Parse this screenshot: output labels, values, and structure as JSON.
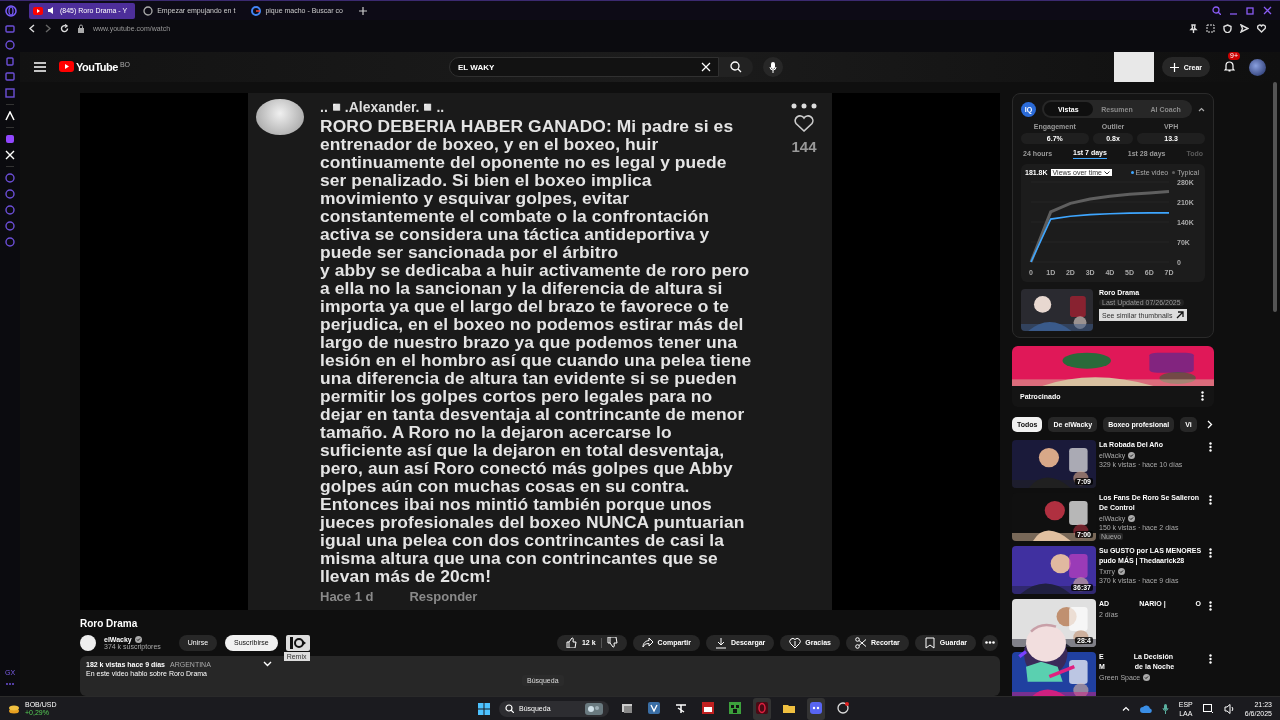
{
  "browser": {
    "tabs": [
      {
        "label": "(845) Roro Drama - Y",
        "selected": true,
        "kind": "youtube"
      },
      {
        "label": "Empezar empujando en t",
        "selected": false,
        "kind": "web"
      },
      {
        "label": "pique macho - Buscar co",
        "selected": false,
        "kind": "google"
      }
    ],
    "url": "www.youtube.com/watch",
    "sidebar_label": "GX"
  },
  "header": {
    "logo": "YouTube",
    "country": "BO",
    "search": {
      "value": "EL WAKY"
    },
    "create": "Crear",
    "notifications": "9+"
  },
  "comment": {
    "author": "..◽.Alexander.◽..",
    "text": "RORO DEBERIA HABER GANADO: Mi padre si es\nentrenador de boxeo, y en el boxeo, huir\ncontinuamente del oponente no es legal y puede\nser penalizado. Si bien el boxeo implica\nmovimiento y esquivar golpes, evitar\nconstantemente el combate o la confrontación\nactiva se considera una táctica antideportiva y\npuede ser sancionada por el árbitro\ny abby se dedicaba a huir activamente de roro pero\na ella no la sancionan y la diferencia de altura si\nimporta ya que el largo del brazo te favorece o te\nperjudica, en el boxeo no podemos estirar más del\nlargo de nuestro brazo ya que podemos tener una\nlesión en el hombro así que cuando una pelea tiene\nuna diferencia de altura tan evidente si se pueden\npermitir los golpes cortos pero legales para no\ndejar en tanta desventaja al contrincante de menor\ntamaño. A Roro no la dejaron acercarse lo\nsuficiente así que la dejaron en total desventaja,\npero, aun así Roro conectó más golpes que Abby\ngolpes aún con muchas cosas en su contra.\nEntonces ibai nos mintió también porque unos\njueces profesionales del boxeo NUNCA puntuarian\nigual una pelea con dos contrincantes de casi la\nmisma altura que una con contrincantes que se\nllevan más de 20cm!",
    "likes": "144",
    "time": "Hace 1 d",
    "reply": "Responder"
  },
  "video": {
    "title": "Roro Drama",
    "channel": "elWacky",
    "subscribers": "374 k suscriptores",
    "join": "Unirse",
    "subscribe": "Suscribirse",
    "remix_tooltip": "Remix",
    "likes": "12 k",
    "actions": [
      {
        "label": "Compartir",
        "kind": "share"
      },
      {
        "label": "Descargar",
        "kind": "download"
      },
      {
        "label": "Gracias",
        "kind": "thanks"
      },
      {
        "label": "Recortar",
        "kind": "clip"
      },
      {
        "label": "Guardar",
        "kind": "save"
      }
    ],
    "description": {
      "stats": "182 k vistas hace 9 días",
      "country": "ARGENTINA",
      "text": "En este video hablo sobre Roro Drama"
    }
  },
  "extension": {
    "badge": "IQ",
    "tabs": [
      {
        "label": "Vistas",
        "selected": true
      },
      {
        "label": "Resumen",
        "selected": false
      },
      {
        "label": "AI Coach",
        "selected": false
      }
    ],
    "stats": [
      {
        "label": "Engagement",
        "value": "6.7%"
      },
      {
        "label": "Outlier",
        "value": "0.8x"
      },
      {
        "label": "VPH",
        "value": "13.3"
      }
    ],
    "periods": [
      {
        "label": "24 hours",
        "selected": false,
        "disabled": false
      },
      {
        "label": "1st 7 days",
        "selected": true,
        "disabled": false
      },
      {
        "label": "1st 28 days",
        "selected": false,
        "disabled": false
      },
      {
        "label": "Todo",
        "selected": false,
        "disabled": true
      }
    ],
    "total": "181.8K",
    "metric": "Views over time",
    "chart_data": {
      "type": "line",
      "xlim": [
        0,
        7
      ],
      "x": [
        0,
        1,
        2,
        3,
        4,
        5,
        6,
        7
      ],
      "xticks": [
        {
          "value": 0,
          "label": "0"
        },
        {
          "value": 1,
          "label": "1D"
        },
        {
          "value": 2,
          "label": "2D"
        },
        {
          "value": 3,
          "label": "3D"
        },
        {
          "value": 4,
          "label": "4D"
        },
        {
          "value": 5,
          "label": "5D"
        },
        {
          "value": 6,
          "label": "6D"
        },
        {
          "value": 7,
          "label": "7D"
        }
      ],
      "ylim": [
        0,
        280000
      ],
      "yticks": [
        {
          "value": 0,
          "label": "0"
        },
        {
          "value": 70000,
          "label": "70K"
        },
        {
          "value": 140000,
          "label": "140K"
        },
        {
          "value": 210000,
          "label": "210K"
        },
        {
          "value": 280000,
          "label": "280K"
        }
      ],
      "series": [
        {
          "name": "Este video",
          "color": "#3ea6ff",
          "values": [
            0,
            150000,
            160000,
            166000,
            169000,
            171000,
            172000,
            172000
          ]
        },
        {
          "name": "Typical",
          "color": "#5f5f5f",
          "values": [
            0,
            175000,
            205000,
            220000,
            230000,
            237000,
            242000,
            247000
          ]
        }
      ]
    },
    "thumb": {
      "title": "Roro Drama",
      "updated": "Last Updated 07/26/2025",
      "button": "See similar thumbnails"
    }
  },
  "ad": {
    "kind": "picture",
    "label": "Patrocinado"
  },
  "chips": [
    {
      "label": "Todos",
      "selected": true
    },
    {
      "label": "De elWacky",
      "selected": false
    },
    {
      "label": "Boxeo profesional",
      "selected": false
    },
    {
      "label": "Vi",
      "selected": false
    }
  ],
  "recommendations": [
    {
      "title_parts": [
        "La Robada Del Año"
      ],
      "channel": "elWacky",
      "meta": "329 k vistas · hace 10 días",
      "duration": "7:09"
    },
    {
      "title_parts": [
        "Los Fans De Roro Se Salieron De Control"
      ],
      "channel": "elWacky",
      "meta": "150 k vistas · hace 2 días",
      "badge": "Nuevo",
      "duration": "7:00"
    },
    {
      "title_parts": [
        "Su GUSTO por LAS MENORES pudo MÁS | Thedaarick28"
      ],
      "channel": "Txrry",
      "meta": "370 k vistas · hace 9 días",
      "duration": "36:37"
    },
    {
      "title_parts": [
        "AD",
        "NARIO |",
        "O"
      ],
      "meta": "2 días",
      "duration": "28:4"
    },
    {
      "title_parts": [
        "E",
        "La Decisión",
        "M",
        "de la Noche"
      ],
      "channel": "Green Space"
    }
  ],
  "tooltip": "Búsqueda",
  "taskbar": {
    "ticker": "BOB/USD",
    "change": "+0,29%",
    "search": "Búsqueda",
    "language": "ESP",
    "layout": "LAA",
    "time": "21:23",
    "date": "6/6/2025"
  }
}
